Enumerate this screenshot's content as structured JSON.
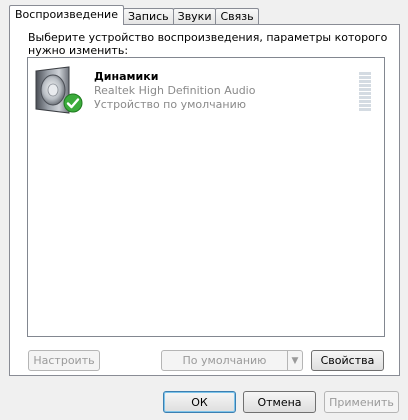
{
  "tabs": [
    {
      "label": "Воспроизведение",
      "active": true
    },
    {
      "label": "Запись",
      "active": false
    },
    {
      "label": "Звуки",
      "active": false
    },
    {
      "label": "Связь",
      "active": false
    }
  ],
  "prompt": {
    "line1": "Выберите устройство воспроизведения, параметры которого",
    "line2": "нужно изменить:"
  },
  "devices": [
    {
      "name": "Динамики",
      "driver": "Realtek High Definition Audio",
      "status": "Устройство по умолчанию",
      "icon": "speaker-icon",
      "badge": "checkmark-icon",
      "level": 0
    }
  ],
  "panel_buttons": {
    "configure": "Настроить",
    "set_default": "По умолчанию",
    "dropdown_arrow": "▼",
    "properties": "Свойства"
  },
  "dialog_buttons": {
    "ok": "ОК",
    "cancel": "Отмена",
    "apply": "Применить"
  },
  "colors": {
    "badge_green": "#3bab3b",
    "meter_segment": "#d4dbe2",
    "default_button_border": "#3c7fb1"
  }
}
